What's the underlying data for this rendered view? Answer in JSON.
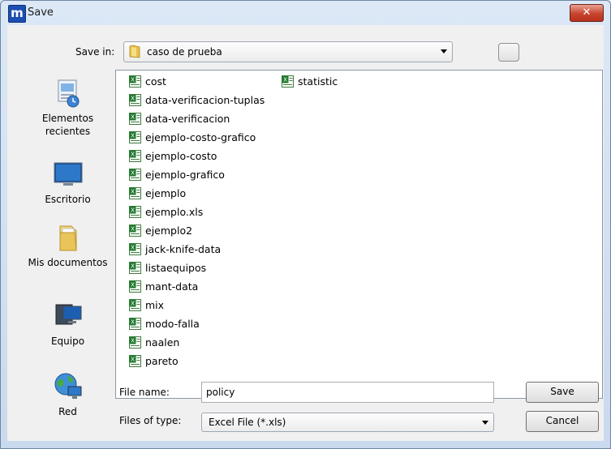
{
  "window": {
    "title": "Save",
    "app_icon_letter": "m",
    "close_label": "✕"
  },
  "save_in": {
    "label": "Save in:",
    "value": "caso de prueba"
  },
  "places": [
    {
      "label": "Elementos recientes",
      "icon": "recent-places-icon"
    },
    {
      "label": "Escritorio",
      "icon": "desktop-icon"
    },
    {
      "label": "Mis documentos",
      "icon": "documents-icon"
    },
    {
      "label": "Equipo",
      "icon": "computer-icon"
    },
    {
      "label": "Red",
      "icon": "network-icon"
    }
  ],
  "files": [
    "cost",
    "data-verificacion-tuplas",
    "data-verificacion",
    "ejemplo-costo-grafico",
    "ejemplo-costo",
    "ejemplo-grafico",
    "ejemplo",
    "ejemplo.xls",
    "ejemplo2",
    "jack-knife-data",
    "listaequipos",
    "mant-data",
    "mix",
    "modo-falla",
    "naalen",
    "pareto",
    "statistic"
  ],
  "file_name": {
    "label": "File name:",
    "value": "policy"
  },
  "file_type": {
    "label": "Files of type:",
    "value": "Excel File (*.xls)"
  },
  "buttons": {
    "save": "Save",
    "cancel": "Cancel"
  },
  "colors": {
    "excel_green": "#1f7a2e",
    "title_bar": "#dce8f6",
    "close_red": "#c7442e"
  }
}
